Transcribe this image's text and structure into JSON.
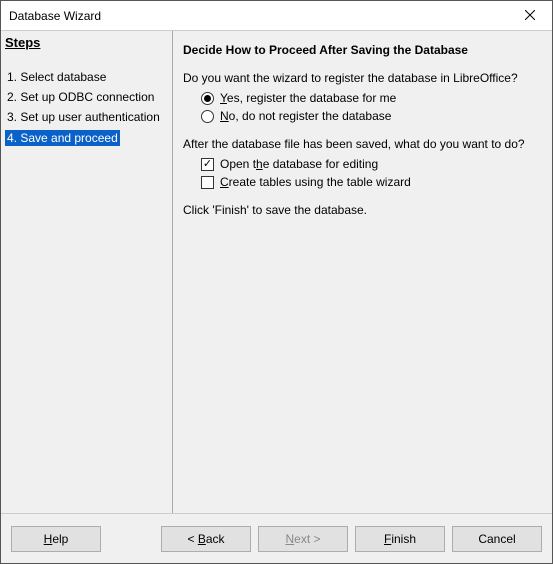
{
  "window": {
    "title": "Database Wizard"
  },
  "steps": {
    "header": "Steps",
    "items": [
      {
        "label": "1. Select database"
      },
      {
        "label": "2. Set up ODBC connection"
      },
      {
        "label": "3. Set up user authentication"
      },
      {
        "label": "4. Save and proceed",
        "active": true
      }
    ]
  },
  "content": {
    "heading": "Decide How to Proceed After Saving the Database",
    "registerQuestion": "Do you want the wizard to register the database in LibreOffice?",
    "registerYes": {
      "pre": "Y",
      "rest": "es, register the database for me",
      "checked": true
    },
    "registerNo": {
      "pre": "N",
      "rest": "o, do not register the database",
      "checked": false
    },
    "afterSaveQuestion": "After the database file has been saved, what do you want to do?",
    "openEdit": {
      "pre": "Open t",
      "u": "h",
      "post": "e database for editing",
      "checked": true
    },
    "createTbl": {
      "u": "C",
      "post": "reate tables using the table wizard",
      "checked": false
    },
    "finishHint": "Click 'Finish' to save the database."
  },
  "buttons": {
    "help": {
      "u": "H",
      "post": "elp"
    },
    "back": {
      "pre": "< ",
      "u": "B",
      "post": "ack"
    },
    "next": {
      "u": "N",
      "post": "ext >",
      "disabled": true
    },
    "finish": {
      "u": "F",
      "post": "inish"
    },
    "cancel": {
      "label": "Cancel"
    }
  }
}
